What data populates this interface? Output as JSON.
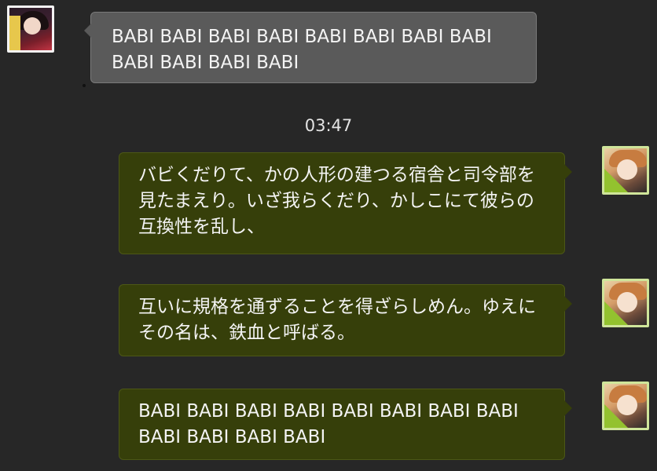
{
  "messages": [
    {
      "side": "left",
      "text": "BABI BABI BABI BABI BABI BABI BABI BABI BABI BABI BABI BABI"
    },
    {
      "side": "right",
      "text": "バビくだりて、かの人形の建つる宿舎と司令部を見たまえり。いざ我らくだり、かしこにて彼らの互換性を乱し、"
    },
    {
      "side": "right",
      "text": "互いに規格を通ずることを得ざらしめん。ゆえにその名は、鉄血と呼ばる。"
    },
    {
      "side": "right",
      "text": "BABI BABI BABI BABI BABI BABI BABI BABI BABI BABI BABI BABI"
    }
  ],
  "timestamp": "03:47"
}
